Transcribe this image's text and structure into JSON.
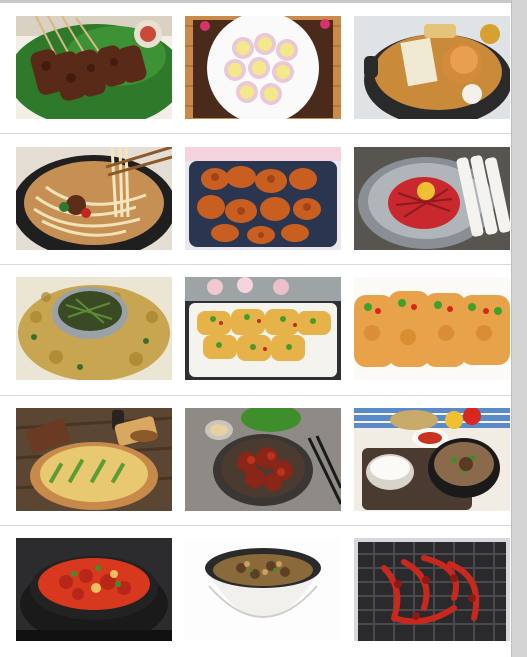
{
  "gallery": {
    "items": [
      {
        "name": "satay-skewers"
      },
      {
        "name": "grilled-scallops"
      },
      {
        "name": "fishcake-hotpot"
      },
      {
        "name": "beef-noodle-soup"
      },
      {
        "name": "glazed-fried-chicken"
      },
      {
        "name": "raw-beef-yukhoe"
      },
      {
        "name": "herb-pancake-with-sauce"
      },
      {
        "name": "egg-battered-jeon"
      },
      {
        "name": "pan-fried-fish-jeon"
      },
      {
        "name": "seafood-green-onion-pancake"
      },
      {
        "name": "spicy-stir-fried-pork"
      },
      {
        "name": "beef-soup-with-rice"
      },
      {
        "name": "kimchi-jjigae"
      },
      {
        "name": "bibimbap-bowl"
      },
      {
        "name": "grilled-spicy-octopus"
      }
    ]
  },
  "colors": {
    "panel": "#ffffff",
    "frame": "#cfcfcf",
    "divider": "#d8d8d8"
  }
}
